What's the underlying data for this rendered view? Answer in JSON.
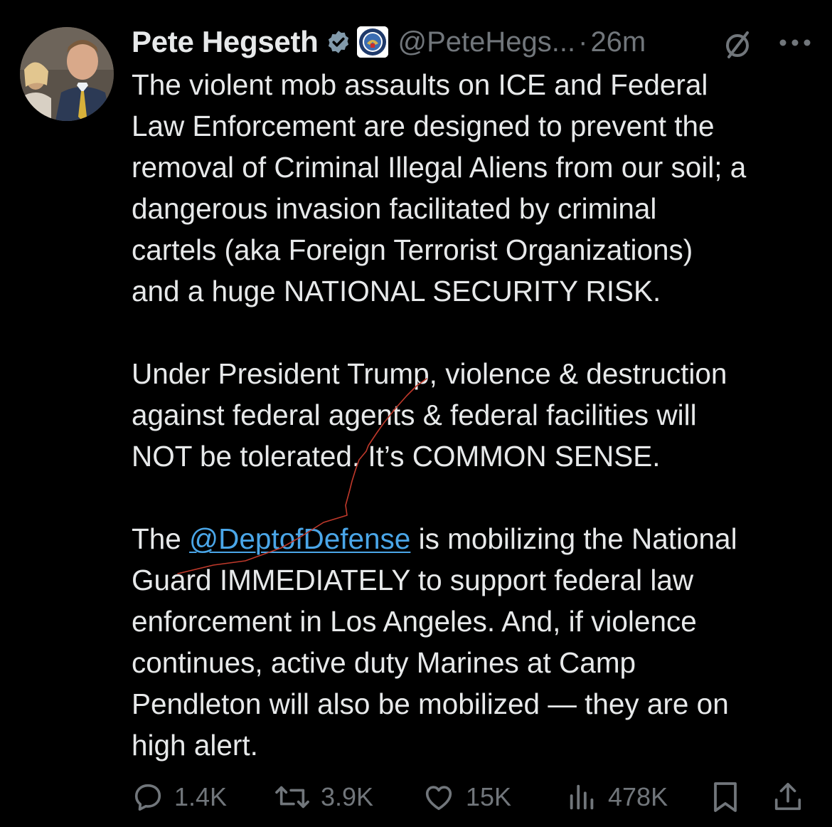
{
  "author": {
    "display_name": "Pete Hegseth",
    "handle": "@PeteHegs...",
    "separator": "·",
    "time": "26m"
  },
  "post": {
    "paragraphs": [
      [
        "The violent mob assaults on ICE and Federal",
        "Law Enforcement are designed to prevent the",
        "removal of Criminal Illegal Aliens from our soil; a",
        "dangerous invasion facilitated by criminal",
        "cartels (aka Foreign Terrorist Organizations)",
        "and a huge NATIONAL SECURITY RISK."
      ],
      [
        "Under President Trump, violence & destruction",
        "against federal agents & federal facilities will",
        "NOT be tolerated. It’s COMMON SENSE."
      ]
    ],
    "mention_line": {
      "prefix": "The ",
      "mention": "@DeptofDefense",
      "suffix": " is mobilizing the National"
    },
    "final_lines": [
      "Guard IMMEDIATELY to support federal law",
      "enforcement in Los Angeles. And, if violence",
      "continues, active duty Marines at Camp",
      "Pendleton will also be mobilized — they are on",
      "high alert."
    ]
  },
  "actions": {
    "replies": "1.4K",
    "reposts": "3.9K",
    "likes": "15K",
    "views": "478K"
  },
  "icons": {
    "verified": "verified-badge-icon",
    "affiliation": "dod-seal-icon",
    "grok": "grok-icon",
    "more": "more-icon",
    "reply": "reply-icon",
    "repost": "repost-icon",
    "like": "heart-icon",
    "views": "views-icon",
    "bookmark": "bookmark-icon",
    "share": "share-icon"
  },
  "colors": {
    "background": "#000000",
    "text": "#e7e9ea",
    "secondary": "#71767b",
    "link": "#4aa6e8",
    "verified": "#829aab",
    "annotation": "#c0392b"
  }
}
